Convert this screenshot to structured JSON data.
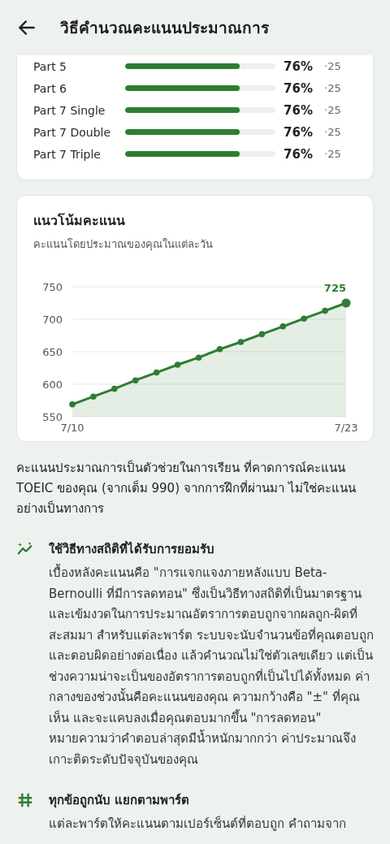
{
  "header": {
    "title": "วิธีคำนวณคะแนนประมาณการ"
  },
  "parts": [
    {
      "name": "Part 5",
      "level": 0.76,
      "percent": "76%",
      "count": "·25"
    },
    {
      "name": "Part 6",
      "level": 0.76,
      "percent": "76%",
      "count": "·25"
    },
    {
      "name": "Part 7 Single",
      "level": 0.76,
      "percent": "76%",
      "count": "·25"
    },
    {
      "name": "Part 7 Double",
      "level": 0.76,
      "percent": "76%",
      "count": "·25"
    },
    {
      "name": "Part 7 Triple",
      "level": 0.76,
      "percent": "76%",
      "count": "·25"
    }
  ],
  "trend": {
    "title": "แนวโน้มคะแนน",
    "subtitle": "คะแนนโดยประมาณของคุณในแต่ละวัน",
    "latest_label": "725",
    "chart_data": {
      "type": "area",
      "categories": [
        "7/10",
        null,
        null,
        null,
        null,
        null,
        null,
        null,
        null,
        null,
        null,
        null,
        null,
        "7/23"
      ],
      "grid": true,
      "series": [
        {
          "color": "#2e7d32",
          "values": [
            569,
            581,
            593,
            606,
            618,
            630,
            641,
            654,
            665,
            677,
            689,
            701,
            713,
            725
          ]
        }
      ],
      "ylim": [
        550,
        750
      ],
      "yticks": [
        550,
        600,
        650,
        700,
        750
      ]
    }
  },
  "intro": "คะแนนประมาณการเป็นตัวช่วยในการเรียน ที่คาดการณ์คะแนน TOEIC ของคุณ (จากเต็ม 990) จากการฝึกที่ผ่านมา ไม่ใช่คะแนนอย่างเป็นทางการ",
  "sections": [
    {
      "kind": "trend",
      "title": "ใช้วิธีทางสถิติที่ได้รับการยอมรับ",
      "body": "เบื้องหลังคะแนนคือ \"การแจกแจงภายหลังแบบ Beta-Bernoulli ที่มีการลดทอน\" ซึ่งเป็นวิธีทางสถิติที่เป็นมาตรฐานและเข้มงวดในการประมาณอัตราการตอบถูกจากผลถูก-ผิดที่สะสมมา สำหรับแต่ละพาร์ต ระบบจะนับจำนวนข้อที่คุณตอบถูกและตอบผิดอย่างต่อเนื่อง แล้วคำนวณไม่ใช่ตัวเลขเดียว แต่เป็นช่วงความน่าจะเป็นของอัตราการตอบถูกที่เป็นไปได้ทั้งหมด ค่ากลางของช่วงนั้นคือคะแนนของคุณ ความกว้างคือ \"±\" ที่คุณเห็น และจะแคบลงเมื่อคุณตอบมากขึ้น \"การลดทอน\" หมายความว่าคำตอบล่าสุดมีน้ำหนักมากกว่า ค่าประมาณจึงเกาะติดระดับปัจจุบันของคุณ"
    },
    {
      "kind": "hash",
      "title": "ทุกข้อถูกนับ แยกตามพาร์ต",
      "body": "แต่ละพาร์ตให้คะแนนตามเปอร์เซ็นต์ที่ตอบถูก คำถามจาก"
    }
  ]
}
